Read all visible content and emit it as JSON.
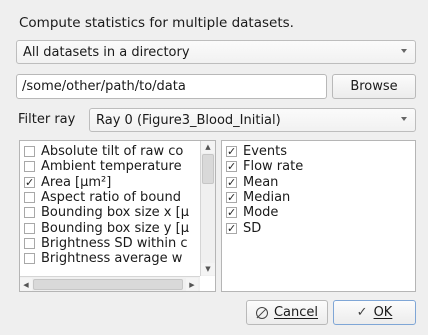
{
  "dialog": {
    "heading": "Compute statistics for multiple datasets."
  },
  "source_combo": {
    "value": "All datasets in a directory"
  },
  "path": {
    "value": "/some/other/path/to/data",
    "browse_label": "Browse"
  },
  "filter": {
    "label": "Filter ray",
    "value": "Ray 0 (Figure3_Blood_Initial)"
  },
  "features": [
    {
      "label": "Absolute tilt of raw co",
      "checked": false
    },
    {
      "label": "Ambient temperature",
      "checked": false
    },
    {
      "label": "Area [µm²]",
      "checked": true
    },
    {
      "label": "Aspect ratio of bound",
      "checked": false
    },
    {
      "label": "Bounding box size x [µ",
      "checked": false
    },
    {
      "label": "Bounding box size y [µ",
      "checked": false
    },
    {
      "label": "Brightness SD within c",
      "checked": false
    },
    {
      "label": "Brightness average w",
      "checked": false
    }
  ],
  "statistics": [
    {
      "label": "Events",
      "checked": true
    },
    {
      "label": "Flow rate",
      "checked": true
    },
    {
      "label": "Mean",
      "checked": true
    },
    {
      "label": "Median",
      "checked": true
    },
    {
      "label": "Mode",
      "checked": true
    },
    {
      "label": "SD",
      "checked": true
    }
  ],
  "buttons": {
    "cancel_label": "Cancel",
    "ok_label": "OK"
  },
  "icons": {
    "cancel": "cancel-circle-icon",
    "ok": "checkmark-icon"
  }
}
